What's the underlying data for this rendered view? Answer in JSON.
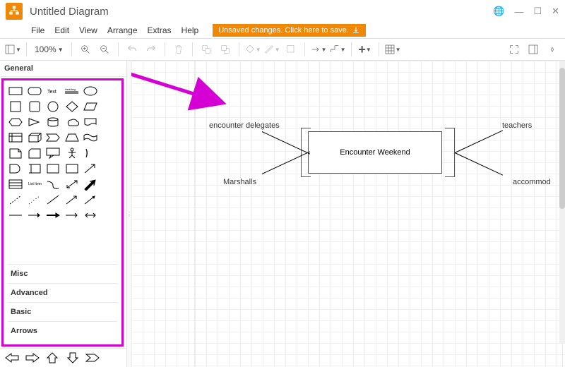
{
  "title": "Untitled Diagram",
  "menu": {
    "file": "File",
    "edit": "Edit",
    "view": "View",
    "arrange": "Arrange",
    "extras": "Extras",
    "help": "Help"
  },
  "unsaved": "Unsaved changes. Click here to save.",
  "zoom": "100%",
  "sidebar": {
    "general": "General",
    "categories": [
      "Misc",
      "Advanced",
      "Basic",
      "Arrows"
    ]
  },
  "diagram": {
    "center": "Encounter Weekend",
    "labels": {
      "topleft": "encounter delegates",
      "botleft": "Marshalls",
      "topright": "teachers",
      "botright": "accommod"
    }
  }
}
